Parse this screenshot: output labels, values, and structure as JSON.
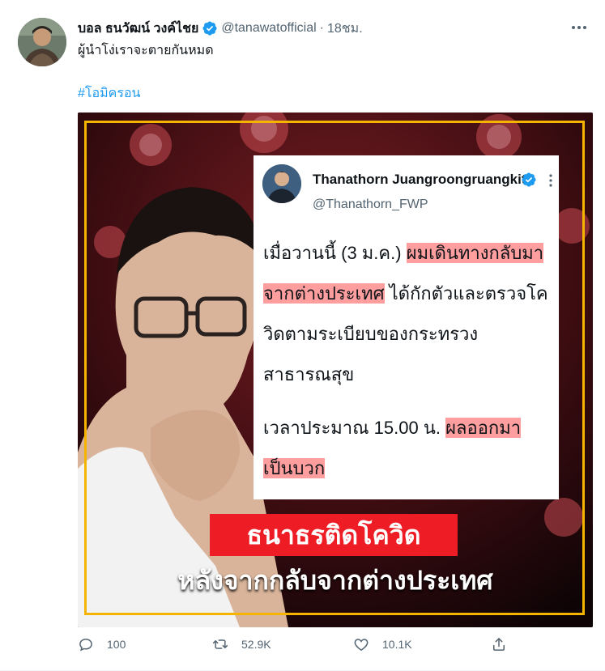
{
  "tweet": {
    "display_name": "บอล ธนวัฒน์ วงค์ไชย",
    "handle": "@tanawatofficial",
    "separator": "·",
    "time": "18ชม.",
    "text": "ผู้นำโง่เราจะตายกันหมด",
    "hashtag": "#โอมิครอน"
  },
  "media": {
    "quoted_card": {
      "name": "Thanathorn Juangroongruangkit",
      "handle": "@Thanathorn_FWP",
      "line1_a": "เมื่อวานนี้ (3 ม.ค.) ",
      "line1_hl": "ผมเดินทางกลับมา",
      "line2_hl": "จากต่างประเทศ",
      "line2_b": " ได้กักตัวและตรวจโค",
      "line3": "วิดตามระเบียบของกระทรวง",
      "line4": "สาธารณสุข",
      "line5_a": "เวลาประมาณ 15.00 น. ",
      "line5_hl": "ผลออกมา",
      "line6_hl": "เป็นบวก"
    },
    "banner_red": "ธนาธรติดโควิด",
    "banner_white": "หลังจากกลับจากต่างประเทศ"
  },
  "actions": {
    "replies": "100",
    "retweets": "52.9K",
    "likes": "10.1K"
  },
  "colors": {
    "accent": "#1d9bf0",
    "muted": "#536471",
    "banner_red": "#ee1c25",
    "frame": "#f5b400",
    "highlight": "#ff9e9e"
  },
  "icons": {
    "verified": "verified-badge-icon",
    "more": "more-dots-icon",
    "reply": "reply-icon",
    "retweet": "retweet-icon",
    "like": "heart-icon",
    "share": "share-icon"
  }
}
